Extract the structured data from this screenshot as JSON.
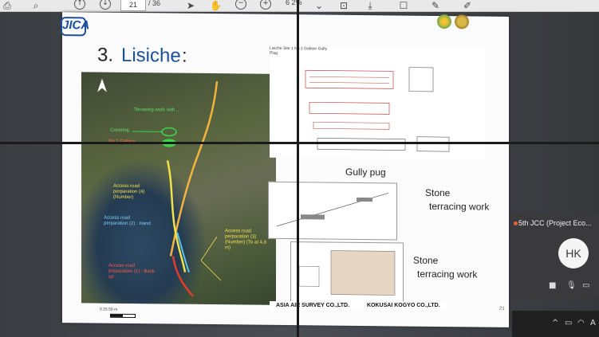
{
  "toolbar": {
    "page_current": "21",
    "page_total": "/ 36",
    "zoom": "6 2%"
  },
  "slide": {
    "logo_text": "JICA",
    "title_num": "3.",
    "title_word": "Lisiche",
    "title_colon": ":",
    "map_labels": {
      "terracing": "Terracing work with ...",
      "covering": "Covering",
      "gabion": "No.1 Gabion",
      "access1": "Access road perparation (4) (Number)",
      "access2": "Access road perparation (2) : Hand",
      "access3": "Access road perparation (3) (Number) (To at 4.8 m)",
      "access4": "Access road preparation (1) : Back up"
    },
    "scale": "0    25   50 m",
    "drawing1_caption": "Lisiche Site 1  No.1 Gabion Gully Plug",
    "gully_label": "Gully pug",
    "stone1_line1": "Stone",
    "stone1_line2": "terracing work",
    "stone2_line1": "Stone",
    "stone2_line2": "terracing work",
    "footer_left": "ASIA AIR SURVEY CO.,LTD.",
    "footer_right": "KOKUSAI KOGYO CO.,LTD.",
    "slide_number": "21"
  },
  "meeting": {
    "title": "5th JCC (Project Eco...",
    "avatar_initials": "HK"
  },
  "icons": [
    "print-icon",
    "search-icon",
    "up-arrow-icon",
    "down-arrow-icon",
    "cursor-icon",
    "hand-icon",
    "zoom-out-icon",
    "zoom-in-icon"
  ]
}
